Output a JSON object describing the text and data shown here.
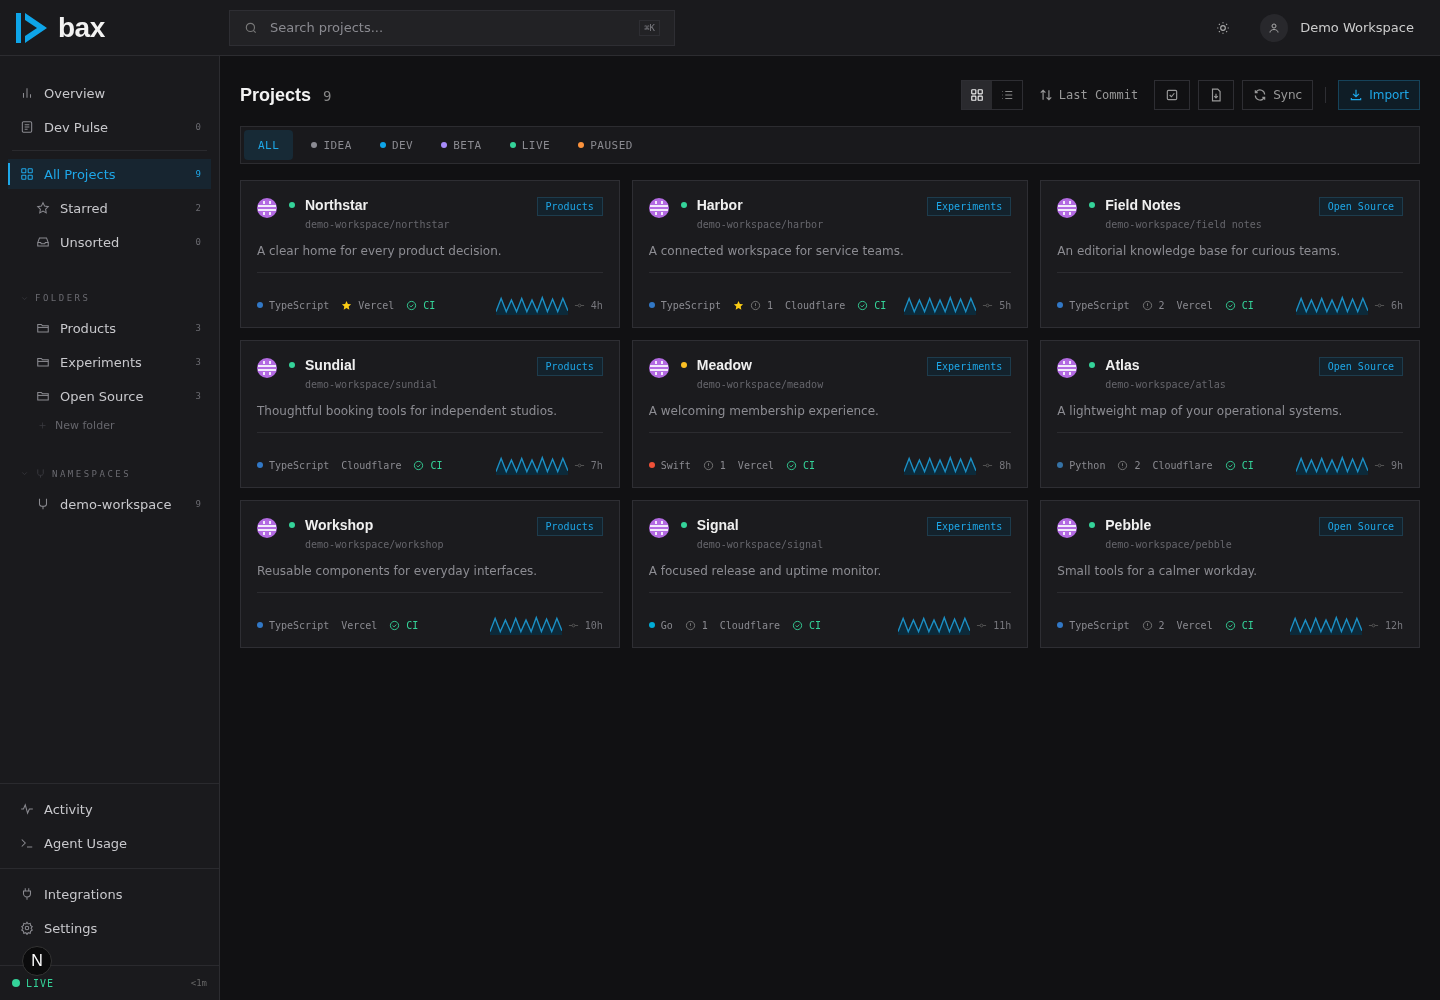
{
  "header": {
    "logo": "bax",
    "search": {
      "placeholder": "Search projects...",
      "shortcut": "⌘K"
    },
    "account": "Demo Workspace"
  },
  "sidebar": {
    "top": [
      {
        "label": "Overview",
        "selected": false
      },
      {
        "label": "Dev Pulse",
        "count": "0",
        "selected": false
      }
    ],
    "projects": [
      {
        "label": "All Projects",
        "count": "9",
        "selected": true
      },
      {
        "label": "Starred",
        "count": "2",
        "selected": false
      },
      {
        "label": "Unsorted",
        "count": "0",
        "selected": false
      }
    ],
    "folders": {
      "title": "FOLDERS",
      "items": [
        {
          "label": "Products",
          "count": "3",
          "selected": false
        },
        {
          "label": "Experiments",
          "count": "3",
          "selected": false
        },
        {
          "label": "Open Source",
          "count": "3",
          "selected": false
        }
      ],
      "new_folder": "New folder"
    },
    "namespaces": {
      "title": "NAMESPACES",
      "items": [
        {
          "label": "demo-workspace",
          "count": "9",
          "selected": false
        }
      ]
    },
    "bottom": [
      {
        "label": "Activity",
        "selected": false
      },
      {
        "label": "Agent Usage",
        "selected": false
      }
    ],
    "footer_links": [
      {
        "label": "Integrations",
        "selected": false
      },
      {
        "label": "Settings",
        "selected": false
      }
    ],
    "status": {
      "label": "LIVE",
      "color": "#34d399",
      "time": "<1m"
    },
    "dev_badge": "N"
  },
  "main": {
    "title": "Projects",
    "count": "9",
    "view_modes": [
      {
        "kind": "grid",
        "selected": true
      },
      {
        "kind": "list",
        "selected": false
      }
    ],
    "sort": "Last Commit",
    "sync": "Sync",
    "import": "Import",
    "filters": [
      {
        "label": "ALL",
        "selected": true
      },
      {
        "label": "IDEA",
        "color": "#8b8b93",
        "selected": false
      },
      {
        "label": "DEV",
        "color": "#0ea5e9",
        "selected": false
      },
      {
        "label": "BETA",
        "color": "#a78bfa",
        "selected": false
      },
      {
        "label": "LIVE",
        "color": "#34d399",
        "selected": false
      },
      {
        "label": "PAUSED",
        "color": "#fb923c",
        "selected": false
      }
    ],
    "projects": [
      {
        "name": "Northstar",
        "color": "#34d399",
        "path": "demo-workspace/northstar",
        "tag": "Products",
        "description": "A clear home for every product decision.",
        "language": {
          "name": "TypeScript",
          "color": "#3178c6"
        },
        "starred": true,
        "deploy": "Vercel",
        "ci": "CI",
        "age": "4h"
      },
      {
        "name": "Harbor",
        "color": "#34d399",
        "path": "demo-workspace/harbor",
        "tag": "Experiments",
        "description": "A connected workspace for service teams.",
        "language": {
          "name": "TypeScript",
          "color": "#3178c6"
        },
        "starred": true,
        "issues": "1",
        "deploy": "Cloudflare",
        "ci": "CI",
        "age": "5h"
      },
      {
        "name": "Field Notes",
        "color": "#34d399",
        "path": "demo-workspace/field notes",
        "tag": "Open Source",
        "description": "An editorial knowledge base for curious teams.",
        "language": {
          "name": "TypeScript",
          "color": "#3178c6"
        },
        "starred": false,
        "issues": "2",
        "deploy": "Vercel",
        "ci": "CI",
        "age": "6h"
      },
      {
        "name": "Sundial",
        "color": "#34d399",
        "path": "demo-workspace/sundial",
        "tag": "Products",
        "description": "Thoughtful booking tools for independent studios.",
        "language": {
          "name": "TypeScript",
          "color": "#3178c6"
        },
        "starred": false,
        "deploy": "Cloudflare",
        "ci": "CI",
        "age": "7h"
      },
      {
        "name": "Meadow",
        "color": "#fbbf24",
        "path": "demo-workspace/meadow",
        "tag": "Experiments",
        "description": "A welcoming membership experience.",
        "language": {
          "name": "Swift",
          "color": "#f05138"
        },
        "starred": false,
        "issues": "1",
        "deploy": "Vercel",
        "ci": "CI",
        "age": "8h"
      },
      {
        "name": "Atlas",
        "color": "#34d399",
        "path": "demo-workspace/atlas",
        "tag": "Open Source",
        "description": "A lightweight map of your operational systems.",
        "language": {
          "name": "Python",
          "color": "#3572a5"
        },
        "starred": false,
        "issues": "2",
        "deploy": "Cloudflare",
        "ci": "CI",
        "age": "9h"
      },
      {
        "name": "Workshop",
        "color": "#34d399",
        "path": "demo-workspace/workshop",
        "tag": "Products",
        "description": "Reusable components for everyday interfaces.",
        "language": {
          "name": "TypeScript",
          "color": "#3178c6"
        },
        "starred": false,
        "deploy": "Vercel",
        "ci": "CI",
        "age": "10h"
      },
      {
        "name": "Signal",
        "color": "#34d399",
        "path": "demo-workspace/signal",
        "tag": "Experiments",
        "description": "A focused release and uptime monitor.",
        "language": {
          "name": "Go",
          "color": "#00add8"
        },
        "starred": false,
        "issues": "1",
        "deploy": "Cloudflare",
        "ci": "CI",
        "age": "11h"
      },
      {
        "name": "Pebble",
        "color": "#34d399",
        "path": "demo-workspace/pebble",
        "tag": "Open Source",
        "description": "Small tools for a calmer workday.",
        "language": {
          "name": "TypeScript",
          "color": "#3178c6"
        },
        "starred": false,
        "issues": "2",
        "deploy": "Vercel",
        "ci": "CI",
        "age": "12h"
      }
    ]
  }
}
